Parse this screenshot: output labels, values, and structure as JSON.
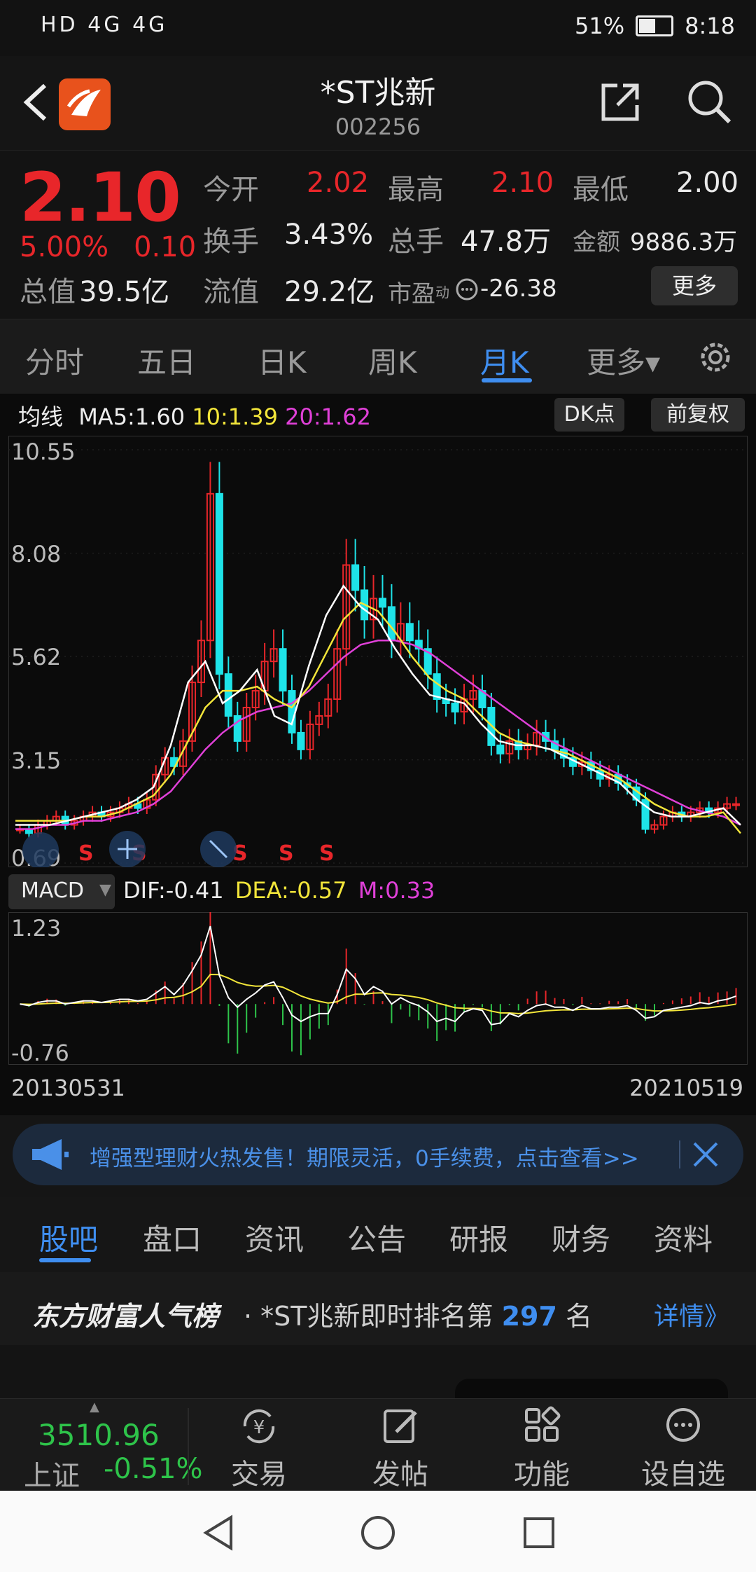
{
  "status_bar": {
    "left": "HD 4G 4G",
    "battery": "51%",
    "battery_level": 0.51,
    "time": "8:18"
  },
  "header": {
    "title": "*ST兆新",
    "code": "002256"
  },
  "quote": {
    "price": "2.10",
    "change_pct": "5.00%",
    "change": "0.10",
    "open_label": "今开",
    "open": "2.02",
    "high_label": "最高",
    "high": "2.10",
    "low_label": "最低",
    "low": "2.00",
    "turnover_label": "换手",
    "turnover": "3.43%",
    "volume_label": "总手",
    "volume": "47.8万",
    "amount_label": "金额",
    "amount": "9886.3万",
    "mktcap_label": "总值",
    "mktcap": "39.5亿",
    "float_label": "流值",
    "float": "29.2亿",
    "pe_label": "市盈",
    "pe_sup": "动",
    "pe": "-26.38",
    "more": "更多"
  },
  "tabs": [
    "分时",
    "五日",
    "日K",
    "周K",
    "月K",
    "更多▾"
  ],
  "active_tab": "月K",
  "ma_bar": {
    "label": "均线",
    "ma5": "MA5:1.60",
    "ma10": "10:1.39",
    "ma20": "20:1.62",
    "dk": "DK点",
    "fq": "前复权"
  },
  "macd_bar": {
    "label": "MACD",
    "dif": "DIF:-0.41",
    "dea": "DEA:-0.57",
    "m": "M:0.33"
  },
  "chart_data": {
    "type": "candlestick",
    "y_ticks": [
      "10.55",
      "8.08",
      "5.62",
      "3.15",
      "0.69"
    ],
    "ylim": [
      0.69,
      10.55
    ],
    "macd_ticks": [
      "1.23",
      "-0.76"
    ],
    "macd_ylim": [
      -0.76,
      1.23
    ],
    "x_start": "20130531",
    "x_end": "20210519",
    "signals": [
      "S",
      "S",
      "S",
      "S",
      "S",
      "S"
    ],
    "close_series": [
      1.5,
      1.4,
      1.6,
      1.7,
      1.8,
      1.6,
      1.7,
      1.8,
      1.9,
      1.8,
      1.9,
      2.0,
      2.1,
      2.0,
      2.2,
      2.8,
      3.2,
      3.0,
      3.6,
      5.0,
      6.0,
      9.5,
      5.2,
      4.2,
      3.6,
      4.4,
      4.8,
      5.5,
      5.8,
      4.8,
      3.8,
      3.4,
      4.0,
      4.2,
      4.6,
      5.8,
      7.8,
      7.2,
      6.5,
      7.0,
      6.8,
      6.0,
      6.4,
      6.0,
      5.8,
      5.2,
      4.6,
      4.5,
      4.3,
      4.6,
      4.8,
      4.4,
      3.5,
      3.3,
      3.6,
      3.4,
      3.5,
      3.8,
      3.6,
      3.4,
      3.2,
      3.0,
      3.1,
      2.9,
      2.7,
      2.8,
      2.6,
      2.5,
      2.2,
      1.5,
      1.6,
      1.8,
      1.9,
      1.8,
      1.9,
      2.0,
      1.9,
      2.0,
      2.1,
      2.1
    ],
    "ma5": [
      1.6,
      1.6,
      1.6,
      1.7,
      1.8,
      1.9,
      2.0,
      2.2,
      2.5,
      3.5,
      5.0,
      5.5,
      4.5,
      4.8,
      5.3,
      4.2,
      4.0,
      5.4,
      6.6,
      7.3,
      6.8,
      6.5,
      5.8,
      5.2,
      4.7,
      4.6,
      4.5,
      4.0,
      3.6,
      3.5,
      3.5,
      3.4,
      3.2,
      3.0,
      2.8,
      2.6,
      2.2,
      1.9,
      1.8,
      1.8,
      1.9,
      2.0,
      1.6
    ],
    "ma10": [
      1.7,
      1.7,
      1.7,
      1.7,
      1.8,
      1.8,
      1.9,
      2.1,
      2.3,
      2.8,
      3.6,
      4.4,
      4.8,
      4.8,
      4.9,
      4.6,
      4.4,
      4.9,
      5.7,
      6.5,
      6.9,
      6.7,
      6.2,
      5.6,
      5.1,
      4.8,
      4.6,
      4.2,
      3.8,
      3.6,
      3.5,
      3.4,
      3.3,
      3.1,
      2.9,
      2.7,
      2.4,
      2.1,
      1.9,
      1.8,
      1.8,
      1.9,
      1.4
    ],
    "ma20": [
      1.5,
      1.5,
      1.6,
      1.6,
      1.7,
      1.7,
      1.8,
      1.9,
      2.1,
      2.4,
      2.9,
      3.4,
      3.8,
      4.1,
      4.3,
      4.4,
      4.5,
      4.8,
      5.2,
      5.6,
      5.9,
      6.0,
      6.0,
      5.9,
      5.7,
      5.4,
      5.1,
      4.8,
      4.5,
      4.2,
      3.9,
      3.6,
      3.4,
      3.2,
      3.0,
      2.8,
      2.6,
      2.4,
      2.2,
      2.0,
      1.9,
      1.8,
      1.6
    ]
  },
  "banner": {
    "text": "增强型理财火热发售！期限灵活，0手续费，点击查看>>"
  },
  "sub_tabs": [
    "股吧",
    "盘口",
    "资讯",
    "公告",
    "研报",
    "财务",
    "资料"
  ],
  "rank": {
    "brand": "东方财富人气榜",
    "prefix": "· *ST兆新即时排名第",
    "num": "297",
    "suffix": "名",
    "detail": "详情》"
  },
  "bottom": {
    "index_value": "3510.96",
    "index_name": "上证",
    "index_change": "-0.51%",
    "items": [
      "交易",
      "发帖",
      "功能",
      "设自选"
    ]
  }
}
